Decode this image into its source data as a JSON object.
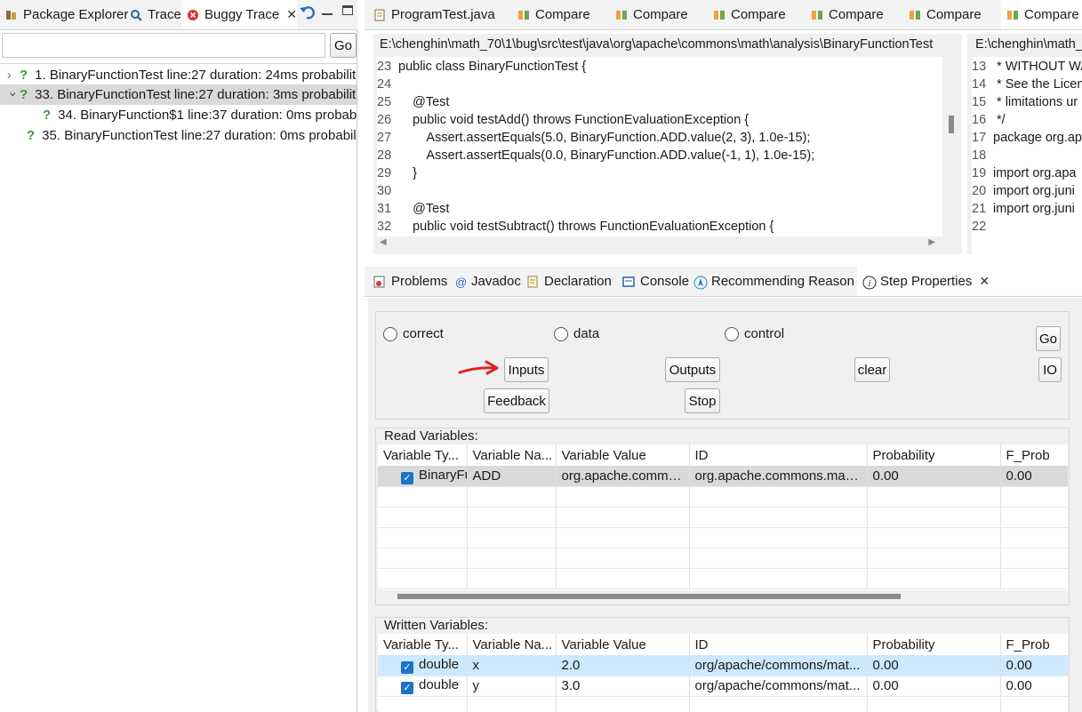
{
  "left_tabs": {
    "package_explorer": "Package Explorer",
    "trace": "Trace",
    "buggy_trace": "Buggy Trace"
  },
  "left_search": {
    "value": "",
    "go": "Go"
  },
  "trace_items": [
    {
      "label": "1. BinaryFunctionTest line:27 duration: 24ms probabilit",
      "expander": "›"
    },
    {
      "label": "33. BinaryFunctionTest line:27 duration: 3ms probabilit",
      "expander": "⌄"
    },
    {
      "label": "34. BinaryFunction$1 line:37 duration: 0ms probabi",
      "expander": ""
    },
    {
      "label": "35. BinaryFunctionTest line:27 duration: 0ms probabilit",
      "expander": ""
    }
  ],
  "editor_tabs": [
    "ProgramTest.java",
    "Compare",
    "Compare",
    "Compare",
    "Compare",
    "Compare",
    "Compare"
  ],
  "compare": {
    "left_path": "E:\\chenghin\\math_70\\1\\bug\\src\\test\\java\\org\\apache\\commons\\math\\analysis\\BinaryFunctionTest",
    "right_path": "E:\\chenghin\\math_",
    "left_lines": [
      {
        "n": "23",
        "t": "public class BinaryFunctionTest {"
      },
      {
        "n": "24",
        "t": ""
      },
      {
        "n": "25",
        "t": "    @Test"
      },
      {
        "n": "26",
        "t": "    public void testAdd() throws FunctionEvaluationException {"
      },
      {
        "n": "27",
        "t": "        Assert.assertEquals(5.0, BinaryFunction.ADD.value(2, 3), 1.0e-15);"
      },
      {
        "n": "28",
        "t": "        Assert.assertEquals(0.0, BinaryFunction.ADD.value(-1, 1), 1.0e-15);"
      },
      {
        "n": "29",
        "t": "    }"
      },
      {
        "n": "30",
        "t": ""
      },
      {
        "n": "31",
        "t": "    @Test"
      },
      {
        "n": "32",
        "t": "    public void testSubtract() throws FunctionEvaluationException {"
      }
    ],
    "right_lines": [
      {
        "n": "13",
        "t": " * WITHOUT WA"
      },
      {
        "n": "14",
        "t": " * See the Licen"
      },
      {
        "n": "15",
        "t": " * limitations ur"
      },
      {
        "n": "16",
        "t": " */"
      },
      {
        "n": "17",
        "t": "package org.ap"
      },
      {
        "n": "18",
        "t": ""
      },
      {
        "n": "19",
        "t": "import org.apa"
      },
      {
        "n": "20",
        "t": "import org.juni"
      },
      {
        "n": "21",
        "t": "import org.juni"
      },
      {
        "n": "22",
        "t": ""
      }
    ]
  },
  "bottom_tabs": {
    "problems": "Problems",
    "javadoc": "Javadoc",
    "declaration": "Declaration",
    "console": "Console",
    "recommending": "Recommending Reason",
    "step_properties": "Step Properties"
  },
  "feedback": {
    "radio_correct": "correct",
    "radio_data": "data",
    "radio_control": "control",
    "go": "Go",
    "inputs": "Inputs",
    "outputs": "Outputs",
    "clear": "clear",
    "io": "IO",
    "feedback": "Feedback",
    "stop": "Stop"
  },
  "read_vars": {
    "title": "Read Variables:",
    "headers": [
      "Variable Ty...",
      "Variable Na...",
      "Variable Value",
      "ID",
      "Probability",
      "F_Prob"
    ],
    "rows": [
      [
        "BinaryFu",
        "ADD",
        "org.apache.commo...",
        "org.apache.commons.math....",
        "0.00",
        "0.00"
      ]
    ]
  },
  "written_vars": {
    "title": "Written Variables:",
    "headers": [
      "Variable Ty...",
      "Variable Na...",
      "Variable Value",
      "ID",
      "Probability",
      "F_Prob"
    ],
    "rows": [
      [
        "double",
        "x",
        "2.0",
        "org/apache/commons/mat...",
        "0.00",
        "0.00"
      ],
      [
        "double",
        "y",
        "3.0",
        "org/apache/commons/mat...",
        "0.00",
        "0.00"
      ]
    ]
  },
  "colors": {
    "selection": "#cde8ff",
    "tree_selection": "#d9d9d9",
    "arrow": "#e02020"
  }
}
